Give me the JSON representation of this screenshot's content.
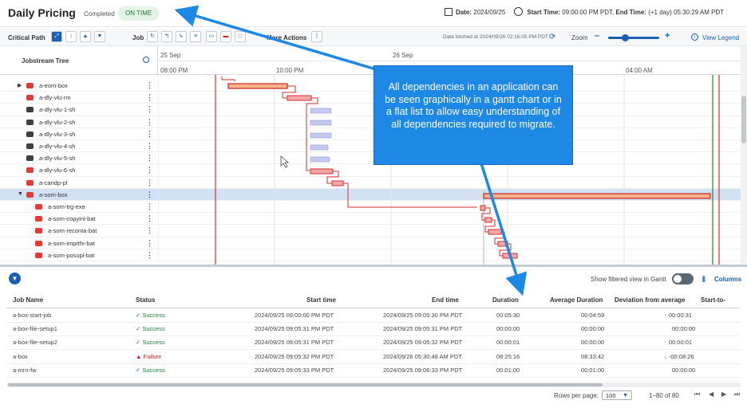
{
  "header": {
    "title": "Daily Pricing",
    "status_text": "Completed",
    "badge": "ON TIME",
    "date_label": "Date:",
    "date_value": "2024/09/25",
    "start_label": "Start Time:",
    "start_value": "09:00:00 PM PDT,",
    "end_label": "End Time:",
    "end_value": "(+1 day) 05:30:29 AM PDT"
  },
  "toolbar": {
    "critical_path": "Critical Path",
    "job": "Job",
    "more_actions": "More Actions",
    "fetched": "Data fetched at 2024/09/26 02:16:05 PM PDT",
    "zoom": "Zoom",
    "view_legend": "View Legend"
  },
  "tree": {
    "title": "Jobstream Tree",
    "rows": [
      {
        "name": "a-eom-box",
        "type": "box"
      },
      {
        "name": "a-dly-vlu-rm",
        "type": "car"
      },
      {
        "name": "a-dly-vlu-1-sh",
        "type": "case"
      },
      {
        "name": "a-dly-vlu-2-sh",
        "type": "case"
      },
      {
        "name": "a-dly-vlu-3-sh",
        "type": "case"
      },
      {
        "name": "a-dly-vlu-4-sh",
        "type": "case"
      },
      {
        "name": "a-dly-vlu-5-sh",
        "type": "case"
      },
      {
        "name": "a-dly-vlu-6-sh",
        "type": "car"
      },
      {
        "name": "a-candp-pl",
        "type": "car"
      },
      {
        "name": "a-som-box",
        "type": "box"
      },
      {
        "name": "a-som-trg-exe",
        "type": "car"
      },
      {
        "name": "a-som-copyini-bat",
        "type": "car"
      },
      {
        "name": "a-som-reconta-bat",
        "type": "car"
      },
      {
        "name": "a-som-imprtfx-bat",
        "type": "car"
      },
      {
        "name": "a-som-posupl-bat",
        "type": "car"
      }
    ]
  },
  "timeline": {
    "dates": [
      "25 Sep",
      "26 Sep"
    ],
    "hours": [
      "08:00 PM",
      "10:00 PM",
      "04:00 AM"
    ]
  },
  "callout": "All dependencies in an application can be seen graphically in a gantt chart or in a flat list to allow easy understanding of all dependencies required to migrate.",
  "grid": {
    "toggle_label": "Show filtered view in Gantt",
    "columns_label": "Columns",
    "headers": [
      "Job Name",
      "Status",
      "Start time",
      "End time",
      "Duration",
      "Average Duration",
      "Deviation from average",
      "Start-to-Runn"
    ],
    "rows": [
      {
        "job": "a-box-start-job",
        "status": "Success",
        "start": "2024/09/25 09:00:00 PM PDT",
        "end": "2024/09/25 09:05:30 PM PDT",
        "duration": "00:05:30",
        "avg": "00:04:59",
        "dev": "00:00:31",
        "dir": "up"
      },
      {
        "job": "a-box-file-setup1",
        "status": "Success",
        "start": "2024/09/25 09:05:31 PM PDT",
        "end": "2024/09/25 09:05:31 PM PDT",
        "duration": "00:00:00",
        "avg": "00:00:00",
        "dev": "00:00:00",
        "dir": ""
      },
      {
        "job": "a-box-file-setup2",
        "status": "Success",
        "start": "2024/09/25 09:05:31 PM PDT",
        "end": "2024/09/25 09:05:32 PM PDT",
        "duration": "00:00:01",
        "avg": "00:00:00",
        "dev": "00:00:01",
        "dir": "up"
      },
      {
        "job": "a-box",
        "status": "Failure",
        "start": "2024/09/25 09:05:32 PM PDT",
        "end": "2024/09/26 05:30:48 AM PDT",
        "duration": "08:25:16",
        "avg": "08:33:42",
        "dev": "-00:08:26",
        "dir": "down"
      },
      {
        "job": "a-mrn-fw",
        "status": "Success",
        "start": "2024/09/25 09:05:33 PM PDT",
        "end": "2024/09/25 09:06:33 PM PDT",
        "duration": "00:01:00",
        "avg": "00:01:00",
        "dev": "00:00:00",
        "dir": ""
      }
    ]
  },
  "pagination": {
    "rows_per_page_label": "Rows per page:",
    "rows_per_page": "100",
    "range": "1–80 of 80"
  },
  "colors": {
    "accent": "#1a5fb4",
    "success": "#237a3a",
    "failure": "#c62828",
    "critical": "#d32f2f",
    "callout": "#1e88e5"
  }
}
